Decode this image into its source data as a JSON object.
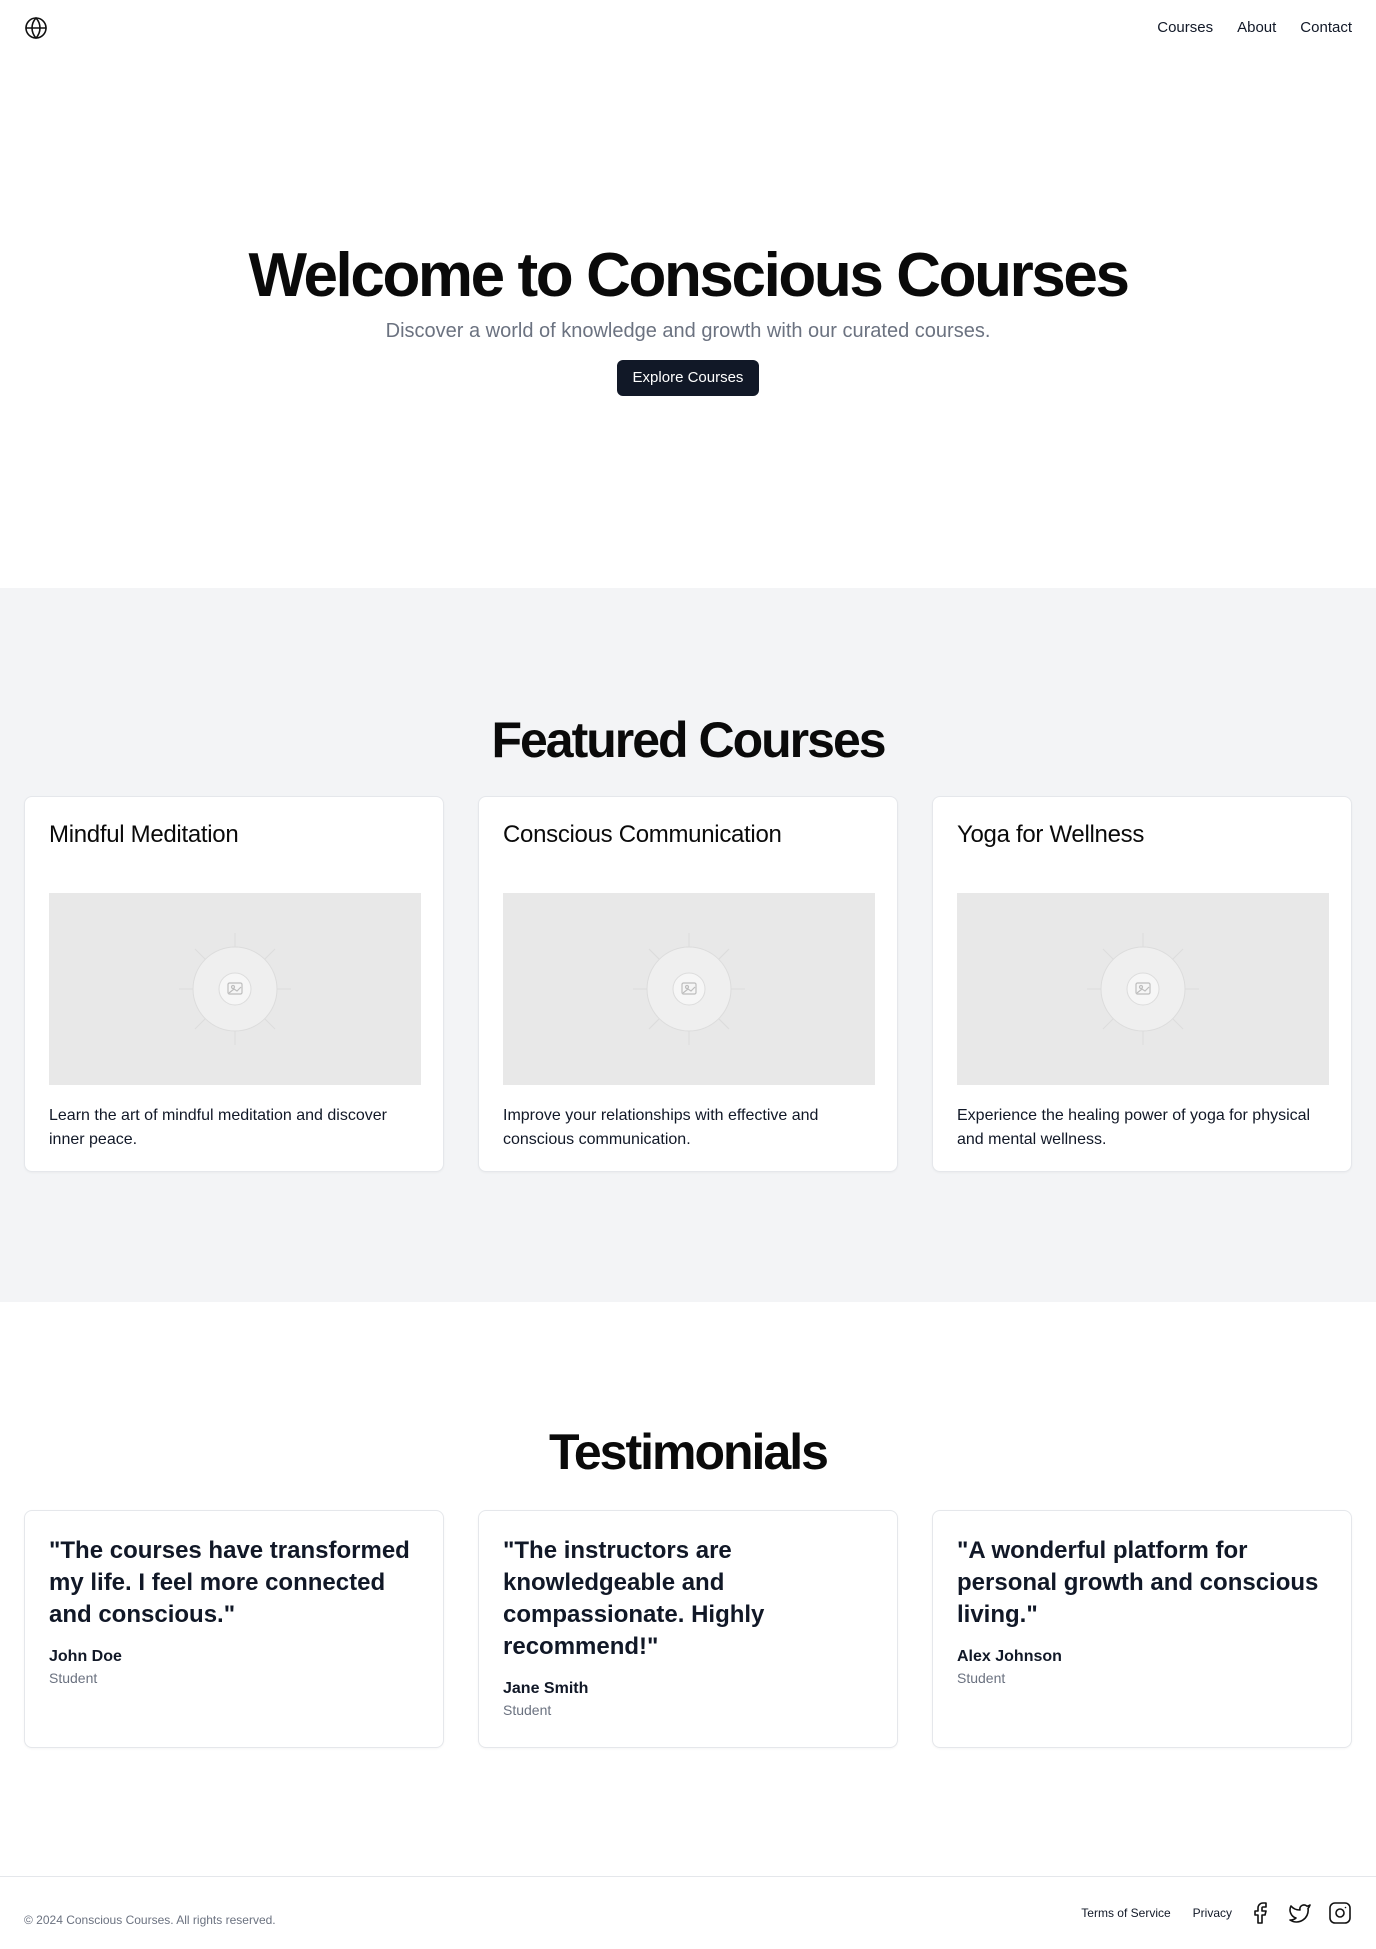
{
  "header": {
    "logo_icon": "globe-icon",
    "nav": [
      {
        "label": "Courses"
      },
      {
        "label": "About"
      },
      {
        "label": "Contact"
      }
    ]
  },
  "hero": {
    "title": "Welcome to Conscious Courses",
    "subtitle": "Discover a world of knowledge and growth with our curated courses.",
    "cta_label": "Explore Courses"
  },
  "featured": {
    "title": "Featured Courses",
    "courses": [
      {
        "title": "Mindful Meditation",
        "description": "Learn the art of mindful meditation and discover inner peace.",
        "image_icon": "image-placeholder-icon"
      },
      {
        "title": "Conscious Communication",
        "description": "Improve your relationships with effective and conscious communication.",
        "image_icon": "image-placeholder-icon"
      },
      {
        "title": "Yoga for Wellness",
        "description": "Experience the healing power of yoga for physical and mental wellness.",
        "image_icon": "image-placeholder-icon"
      }
    ]
  },
  "testimonials": {
    "title": "Testimonials",
    "items": [
      {
        "quote": "\"The courses have transformed my life. I feel more connected and conscious.\"",
        "name": "John Doe",
        "role": "Student"
      },
      {
        "quote": "\"The instructors are knowledgeable and compassionate. Highly recommend!\"",
        "name": "Jane Smith",
        "role": "Student"
      },
      {
        "quote": "\"A wonderful platform for personal growth and conscious living.\"",
        "name": "Alex Johnson",
        "role": "Student"
      }
    ]
  },
  "footer": {
    "copyright": "© 2024 Conscious Courses. All rights reserved.",
    "links": [
      {
        "label": "Terms of Service"
      },
      {
        "label": "Privacy"
      }
    ],
    "social_icons": [
      "facebook-icon",
      "twitter-icon",
      "instagram-icon"
    ]
  },
  "colors": {
    "primary": "#111827",
    "muted_text": "#6b7280",
    "section_bg": "#f3f4f6",
    "border": "#e5e7eb",
    "placeholder_bg": "#e8e8e8"
  }
}
